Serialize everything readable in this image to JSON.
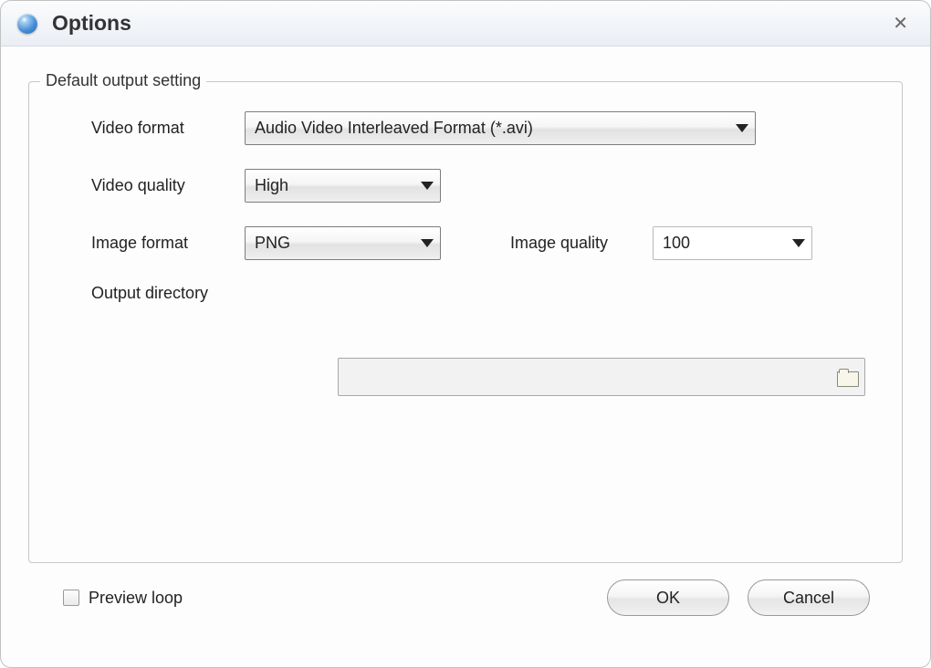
{
  "titlebar": {
    "title": "Options"
  },
  "groupbox": {
    "legend": "Default output setting"
  },
  "labels": {
    "video_format": "Video format",
    "video_quality": "Video quality",
    "image_format": "Image format",
    "image_quality": "Image quality",
    "output_directory": "Output directory"
  },
  "values": {
    "video_format": "Audio Video Interleaved Format (*.avi)",
    "video_quality": "High",
    "image_format": "PNG",
    "image_quality": "100",
    "output_directory": ""
  },
  "bottom": {
    "preview_loop": "Preview loop",
    "ok": "OK",
    "cancel": "Cancel"
  }
}
